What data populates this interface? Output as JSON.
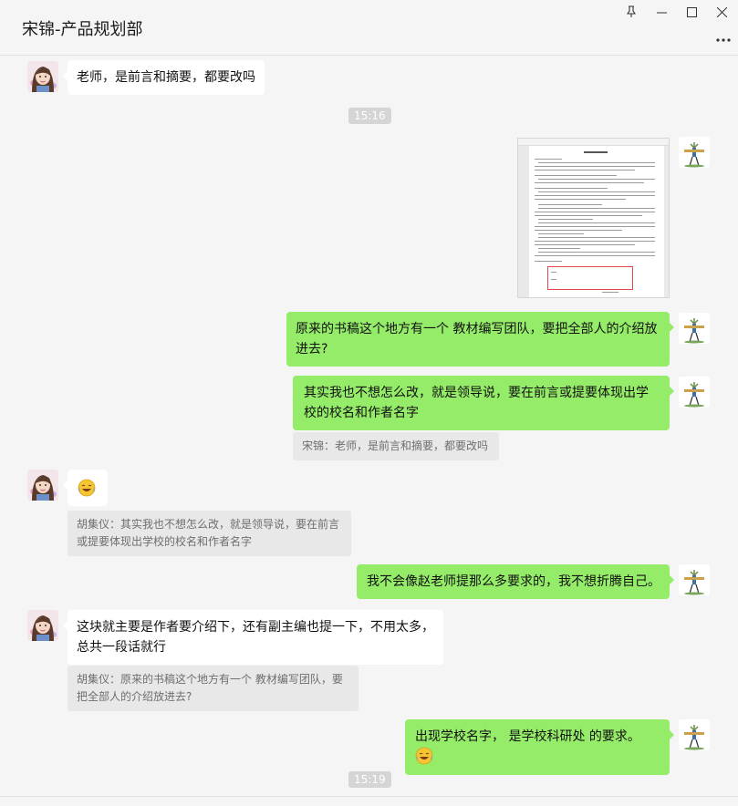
{
  "window": {
    "chat_title": "宋锦-产品规划部",
    "pin_icon": "pin-icon",
    "minimize_icon": "minimize-icon",
    "maximize_icon": "maximize-icon",
    "close_icon": "close-icon",
    "more_icon": "more-icon"
  },
  "messages": {
    "m1": "老师，是前言和摘要，都要改吗",
    "t1": "15:16",
    "m3": "原来的书稿这个地方有一个  教材编写团队，要把全部人的介绍放进去?",
    "m4": "其实我也不想怎么改，就是领导说，要在前言或提要体现出学校的校名和作者名字",
    "q4": "宋锦：老师，是前言和摘要，都要改吗",
    "q5": "胡集仪：其实我也不想怎么改，就是领导说，要在前言或提要体现出学校的校名和作者名字",
    "m6": "我不会像赵老师提那么多要求的，我不想折腾自己。",
    "m7": "这块就主要是作者要介绍下，还有副主编也提一下，不用太多，总共一段话就行",
    "q7": "胡集仪：原来的书稿这个地方有一个  教材编写团队，要把全部人的介绍放进去?",
    "m8": "出现学校名字，  是学校科研处  的要求。",
    "t2": "15:19"
  },
  "icons": {
    "emoji_laugh_cry": "laugh-cry-emoji-icon",
    "doc_image": "document-screenshot-image"
  }
}
